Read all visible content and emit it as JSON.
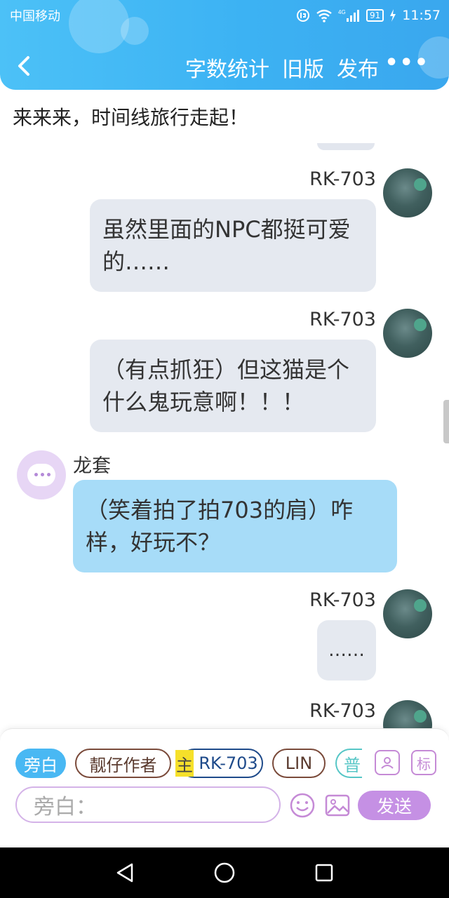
{
  "status_bar": {
    "carrier": "中国移动",
    "network": "4G",
    "battery": "91",
    "time": "11:57"
  },
  "header": {
    "actions": [
      "字数统计",
      "旧版",
      "发布"
    ],
    "more": "•••"
  },
  "topic": "来来来，时间线旅行走起！",
  "messages": [
    {
      "sender": "RK-703",
      "side": "right",
      "text": "虽然里面的NPC都挺可爱的……"
    },
    {
      "sender": "RK-703",
      "side": "right",
      "text": "（有点抓狂）但这猫是个什么鬼玩意啊！！！"
    },
    {
      "sender": "龙套",
      "side": "left",
      "text": "（笑着拍了拍703的肩）咋样，好玩不？"
    },
    {
      "sender": "RK-703",
      "side": "right",
      "text": "……"
    },
    {
      "sender": "RK-703",
      "side": "right",
      "text": ""
    }
  ],
  "roles": {
    "narration": "旁白",
    "author": "靓仔作者",
    "master_tag": "主",
    "rk": "RK-703",
    "lin": "LIN",
    "partial": "普"
  },
  "tools": {
    "role_icon": "user-card-icon",
    "mark": "标"
  },
  "composer": {
    "placeholder": "旁白：",
    "send": "发送"
  },
  "colors": {
    "header": "#3cb2f3",
    "bubble_self": "#e5e9f0",
    "bubble_other": "#a7dcf8",
    "send": "#c590e4"
  }
}
